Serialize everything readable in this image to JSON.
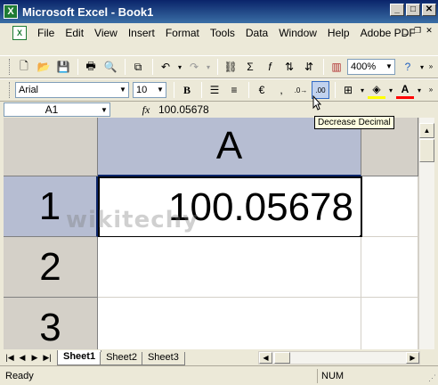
{
  "window": {
    "title": "Microsoft Excel - Book1"
  },
  "menu": {
    "items": [
      "File",
      "Edit",
      "View",
      "Insert",
      "Format",
      "Tools",
      "Data",
      "Window",
      "Help",
      "Adobe PDF"
    ]
  },
  "toolbar": {
    "zoom": "400%"
  },
  "formatting": {
    "font": "Arial",
    "size": "10",
    "bold_label": "B"
  },
  "formula_bar": {
    "name_box": "A1",
    "fx_label": "fx",
    "value": "100.05678"
  },
  "tooltip": {
    "text": "Decrease Decimal"
  },
  "grid": {
    "columns": [
      "A"
    ],
    "rows": [
      "1",
      "2",
      "3"
    ],
    "cell_a1": "100.05678"
  },
  "watermark": {
    "text": "wikitechy"
  },
  "sheets": {
    "tabs": [
      "Sheet1",
      "Sheet2",
      "Sheet3"
    ],
    "active": "Sheet1"
  },
  "status": {
    "ready": "Ready",
    "num": "NUM"
  },
  "colors": {
    "title_start": "#0a246a",
    "title_end": "#3a6ea5",
    "chrome": "#ece9d8",
    "header": "#d4d0c8",
    "header_active": "#b6bdd2"
  }
}
